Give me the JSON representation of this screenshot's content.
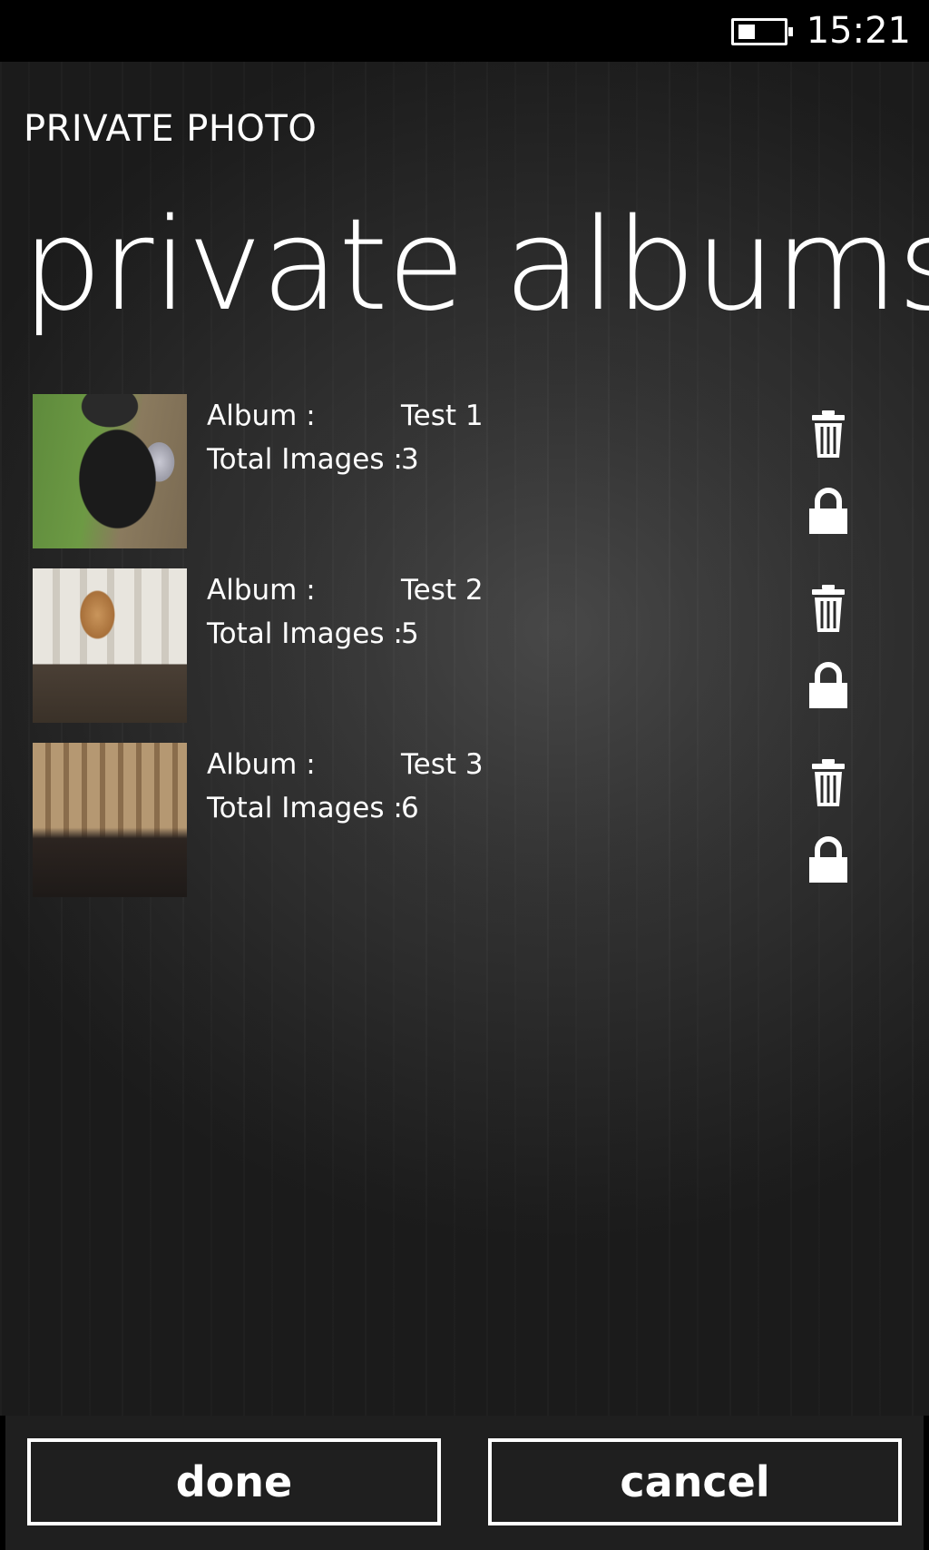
{
  "status_bar": {
    "time": "15:21",
    "battery_icon": "battery-icon",
    "battery_level": 0.35
  },
  "header": {
    "app_title": "PRIVATE PHOTO",
    "page_title": "private albums"
  },
  "albums": [
    {
      "album_label": "Album :",
      "name": "Test 1",
      "count_label": "Total Images :",
      "count": "3",
      "thumbnail": "woman-with-cat-photo",
      "delete_icon": "trash-icon",
      "lock_icon": "lock-icon"
    },
    {
      "album_label": "Album :",
      "name": "Test 2",
      "count_label": "Total Images :",
      "count": "5",
      "thumbnail": "museum-statue-photo",
      "delete_icon": "trash-icon",
      "lock_icon": "lock-icon"
    },
    {
      "album_label": "Album :",
      "name": "Test 3",
      "count_label": "Total Images :",
      "count": "6",
      "thumbnail": "museum-hall-photo",
      "delete_icon": "trash-icon",
      "lock_icon": "lock-icon"
    }
  ],
  "app_bar": {
    "done_label": "done",
    "cancel_label": "cancel"
  },
  "colors": {
    "background": "#000000",
    "text": "#ffffff",
    "app_bar": "#1f1f1f"
  }
}
